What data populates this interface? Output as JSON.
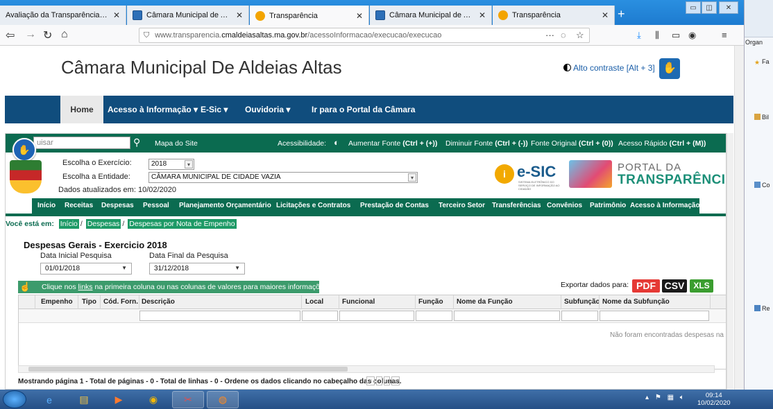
{
  "browser": {
    "tabs": [
      {
        "title": "Avaliação da Transparência dos Jur",
        "icon": "document-icon"
      },
      {
        "title": "Câmara Municipal de Aldeias A",
        "icon": "site-icon"
      },
      {
        "title": "Transparência",
        "icon": "info-icon"
      },
      {
        "title": "Câmara Municipal de Aldeias A",
        "icon": "site-icon"
      },
      {
        "title": "Transparência",
        "icon": "info-icon"
      }
    ],
    "url_prefix": "www.transparencia.",
    "url_domain": "cmaldeiasaltas.ma.gov.br",
    "url_path": "/acessoInformacao/execucao/execucao",
    "menu_dots": "···"
  },
  "explorer": {
    "header": "Organ",
    "items": [
      "Fa",
      "Bil",
      "Co",
      "Re"
    ]
  },
  "header": {
    "title": "Câmara Municipal De Aldeias Altas",
    "contrast": "Alto contraste [Alt + 3]"
  },
  "mainnav": {
    "home": "Home",
    "items": [
      "Acesso à Informação ▾",
      "E-Sic ▾",
      "Ouvidoria ▾",
      "Ir para o Portal da Câmara"
    ]
  },
  "portal": {
    "search_placeholder": "uisar",
    "sitemap": "Mapa do Site",
    "access_label": "Acessibilidade:",
    "font_increase": "Aumentar Fonte",
    "font_increase_key": "(Ctrl + (+))",
    "font_decrease": "Diminuir Fonte",
    "font_decrease_key": "(Ctrl + (-))",
    "font_original": "Fonte Original",
    "font_original_key": "(Ctrl + (0))",
    "quick_access": "Acesso Rápido",
    "quick_access_key": "(Ctrl + (M))",
    "exercise_label": "Escolha o Exercício:",
    "exercise_value": "2018",
    "entity_label": "Escolha a Entidade:",
    "entity_value": "CÂMARA MUNICIPAL DE CIDADE VAZIA",
    "updated": "Dados atualizados em: 10/02/2020",
    "esic": "e-SIC",
    "esic_sub": "SISTEMA ELETRÔNICO DO SERVIÇO DE INFORMAÇÃO AO CIDADÃO",
    "portal_l1": "PORTAL DA",
    "portal_l2": "TRANSPARÊNCIA"
  },
  "menu": [
    "Início",
    "Receitas",
    "Despesas",
    "Pessoal",
    "Planejamento Orçamentário",
    "Licitações e Contratos",
    "Prestação de Contas",
    "Terceiro Setor",
    "Transferências",
    "Convênios",
    "Patrimônio",
    "Acesso à Informação"
  ],
  "breadcrumb": {
    "lead": "Você está em:",
    "items": [
      "Início",
      "Despesas",
      "Despesas por Nota de Empenho"
    ]
  },
  "section": {
    "title": "Despesas Gerais - Exercicio 2018",
    "start_label": "Data Inicial Pesquisa",
    "start_value": "01/01/2018",
    "end_label": "Data Final da Pesquisa",
    "end_value": "31/12/2018"
  },
  "info": {
    "pre": "Clique nos ",
    "link": "links",
    "post": " na primeira coluna ou nas colunas de valores para maiores informações."
  },
  "export": {
    "label": "Exportar dados para:",
    "pdf": "PDF",
    "csv": "CSV",
    "xls": "XLS",
    "colors": {
      "pdf": "#e53935",
      "csv": "#1a1a1a",
      "xls": "#3a9d2f"
    }
  },
  "grid": {
    "columns": [
      "Empenho",
      "Tipo",
      "Cód. Forn.",
      "Descrição",
      "Local",
      "Funcional",
      "Função",
      "Nome da Função",
      "Subfunção",
      "Nome da Subfunção"
    ],
    "empty": "Não foram encontradas despesas na c"
  },
  "status": {
    "text": "Mostrando página 1 - Total de páginas - 0 - Total de linhas - 0 - Ordene os dados clicando no cabeçalho das colunas.",
    "pager": [
      "«",
      "‹",
      "›",
      "»"
    ]
  },
  "taskbar": {
    "time": "09:14",
    "date": "10/02/2020"
  },
  "colors": {
    "brand_blue": "#104d7d",
    "portal_green": "#0b6b50",
    "crumb_green": "#1d9a66",
    "info_green": "#3c9b6c"
  }
}
